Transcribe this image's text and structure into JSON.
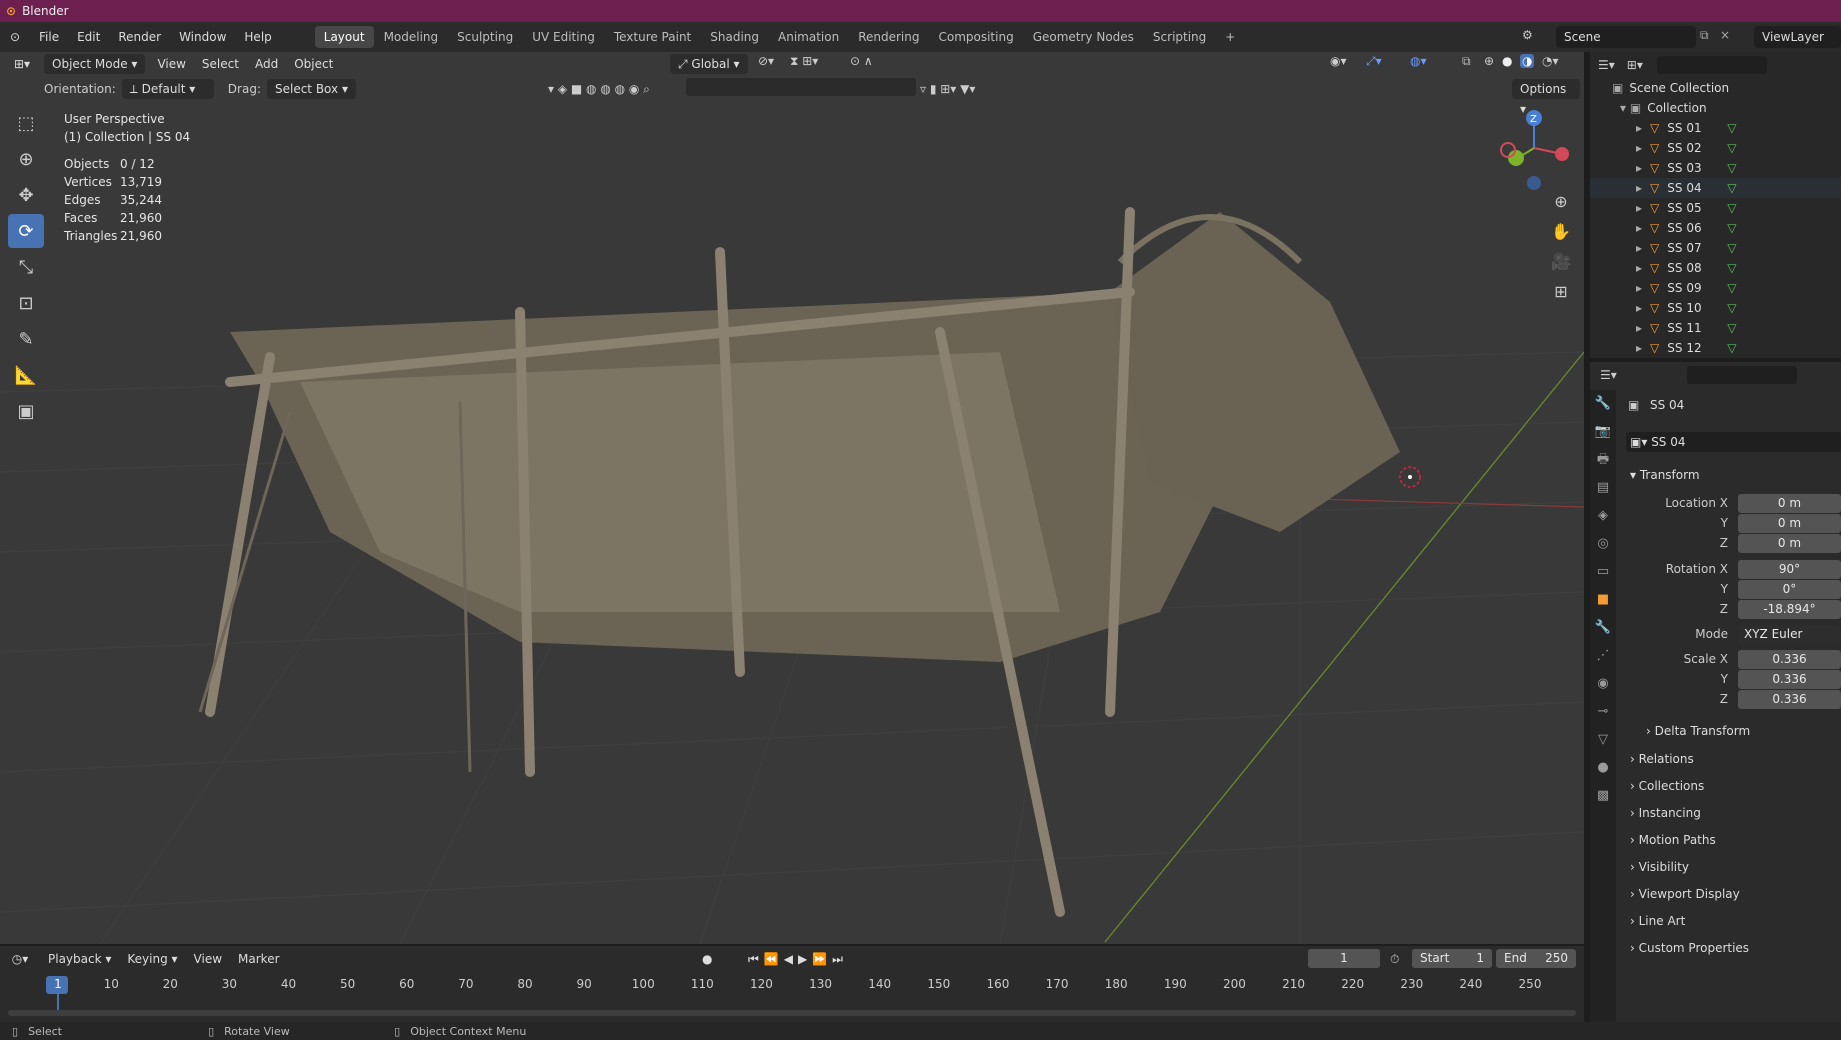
{
  "title": "Blender",
  "menu": [
    "File",
    "Edit",
    "Render",
    "Window",
    "Help"
  ],
  "workspaces": [
    "Layout",
    "Modeling",
    "Sculpting",
    "UV Editing",
    "Texture Paint",
    "Shading",
    "Animation",
    "Rendering",
    "Compositing",
    "Geometry Nodes",
    "Scripting"
  ],
  "scene": "Scene",
  "view_layer": "ViewLayer",
  "viewport": {
    "mode": "Object Mode",
    "menus": [
      "View",
      "Select",
      "Add",
      "Object"
    ],
    "transform_orientation": "Global",
    "orientation_label": "Orientation:",
    "orientation_value": "Default",
    "drag_label": "Drag:",
    "drag_value": "Select Box",
    "options": "Options",
    "perspective": "User Perspective",
    "collection_info": "(1) Collection | SS 04",
    "stats": [
      {
        "k": "Objects",
        "v": "0 / 12"
      },
      {
        "k": "Vertices",
        "v": "13,719"
      },
      {
        "k": "Edges",
        "v": "35,244"
      },
      {
        "k": "Faces",
        "v": "21,960"
      },
      {
        "k": "Triangles",
        "v": "21,960"
      }
    ],
    "gizmo_axis": "Z"
  },
  "outliner": {
    "scene_collection": "Scene Collection",
    "collection": "Collection",
    "items": [
      "SS 01",
      "SS 02",
      "SS 03",
      "SS 04",
      "SS 05",
      "SS 06",
      "SS 07",
      "SS 08",
      "SS 09",
      "SS 10",
      "SS 11",
      "SS 12"
    ]
  },
  "properties": {
    "object_name": "SS 04",
    "object_field": "SS 04",
    "transform": "Transform",
    "location_x_label": "Location X",
    "y_label": "Y",
    "z_label": "Z",
    "location": [
      "0 m",
      "0 m",
      "0 m"
    ],
    "rotation_x_label": "Rotation X",
    "rotation": [
      "90°",
      "0°",
      "-18.894°"
    ],
    "mode_label": "Mode",
    "mode_value": "XYZ Euler",
    "scale_x_label": "Scale X",
    "scale": [
      "0.336",
      "0.336",
      "0.336"
    ],
    "delta": "Delta Transform",
    "panels": [
      "Relations",
      "Collections",
      "Instancing",
      "Motion Paths",
      "Visibility",
      "Viewport Display",
      "Line Art",
      "Custom Properties"
    ]
  },
  "timeline": {
    "menus": [
      "Playback",
      "Keying",
      "View",
      "Marker"
    ],
    "current_frame": "1",
    "start_label": "Start",
    "start": "1",
    "end_label": "End",
    "end": "250",
    "ticks": [
      "1",
      "10",
      "20",
      "30",
      "40",
      "50",
      "60",
      "70",
      "80",
      "90",
      "100",
      "110",
      "120",
      "130",
      "140",
      "150",
      "160",
      "170",
      "180",
      "190",
      "200",
      "210",
      "220",
      "230",
      "240",
      "250"
    ]
  },
  "status": [
    "Select",
    "Rotate View",
    "Object Context Menu"
  ]
}
